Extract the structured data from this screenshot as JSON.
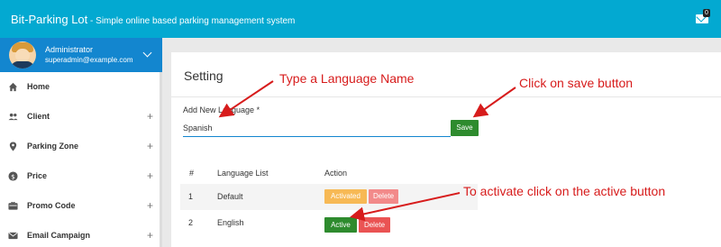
{
  "header": {
    "brand": "Bit-Parking Lot",
    "tagline": " - Simple online based parking management system",
    "mail_badge": "0"
  },
  "user": {
    "name": "Administrator",
    "email": "superadmin@example.com"
  },
  "sidebar": {
    "items": [
      {
        "label": "Home",
        "icon": "home-icon"
      },
      {
        "label": "Client",
        "icon": "people-icon",
        "plus": "+"
      },
      {
        "label": "Parking Zone",
        "icon": "location-pin-icon",
        "plus": "+"
      },
      {
        "label": "Price",
        "icon": "dollar-icon",
        "plus": "+"
      },
      {
        "label": "Promo Code",
        "icon": "gift-card-icon",
        "plus": "+"
      },
      {
        "label": "Email Campaign",
        "icon": "envelope-icon",
        "plus": "+"
      }
    ]
  },
  "page": {
    "title": "Setting",
    "field_label": "Add New Language *",
    "input_value": "Spanish",
    "save_label": "Save"
  },
  "table": {
    "headers": [
      "#",
      "Language List",
      "Action"
    ],
    "rows": [
      {
        "num": "1",
        "name": "Default",
        "status_label": "Activated",
        "delete_label": "Delete"
      },
      {
        "num": "2",
        "name": "English",
        "status_label": "Active",
        "delete_label": "Delete"
      }
    ]
  },
  "annotations": {
    "type_language": "Type a Language Name",
    "click_save": "Click on save button",
    "activate": "To activate click on the active button"
  },
  "colors": {
    "topbar": "#03a9d1",
    "userbox": "#1386cf",
    "success": "#2e8b2e",
    "warning": "#f7b955",
    "danger": "#ea5353",
    "annotation": "#d71c1c"
  }
}
